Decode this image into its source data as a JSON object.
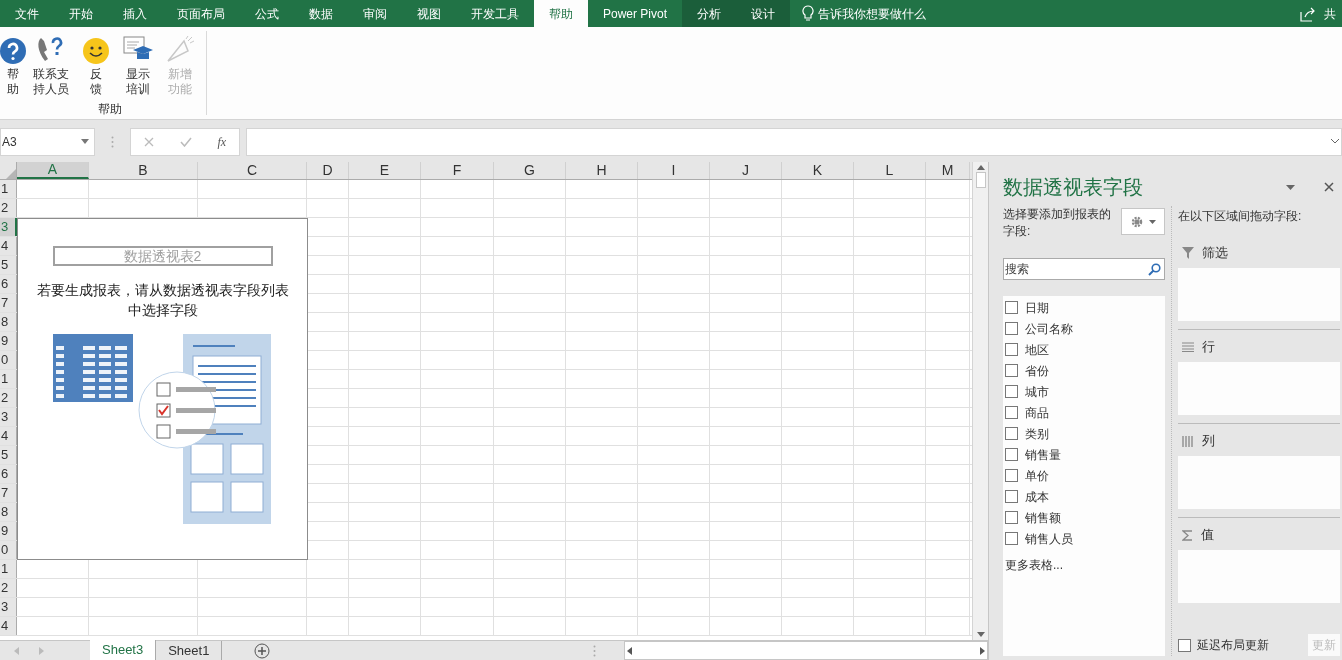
{
  "ribbon_tabs": [
    {
      "label": "文件",
      "selected": false,
      "kind": "normal"
    },
    {
      "label": "开始",
      "selected": false,
      "kind": "normal"
    },
    {
      "label": "插入",
      "selected": false,
      "kind": "normal"
    },
    {
      "label": "页面布局",
      "selected": false,
      "kind": "normal"
    },
    {
      "label": "公式",
      "selected": false,
      "kind": "normal"
    },
    {
      "label": "数据",
      "selected": false,
      "kind": "normal"
    },
    {
      "label": "审阅",
      "selected": false,
      "kind": "normal"
    },
    {
      "label": "视图",
      "selected": false,
      "kind": "normal"
    },
    {
      "label": "开发工具",
      "selected": false,
      "kind": "normal"
    },
    {
      "label": "帮助",
      "selected": true,
      "kind": "normal"
    },
    {
      "label": "Power Pivot",
      "selected": false,
      "kind": "normal"
    },
    {
      "label": "分析",
      "selected": false,
      "kind": "contextual"
    },
    {
      "label": "设计",
      "selected": false,
      "kind": "contextual"
    }
  ],
  "tell_me": "告诉我你想要做什么",
  "share": "共",
  "ribbon_group": {
    "label": "帮助",
    "buttons": [
      {
        "kind": "help",
        "lines": [
          "帮",
          "助"
        ],
        "disabled": false
      },
      {
        "kind": "contact",
        "lines": [
          "联系支",
          "持人员"
        ],
        "disabled": false
      },
      {
        "kind": "feedback",
        "lines": [
          "反",
          "馈"
        ],
        "disabled": false
      },
      {
        "kind": "training",
        "lines": [
          "显示",
          "培训"
        ],
        "disabled": false
      },
      {
        "kind": "whatsnew",
        "lines": [
          "新增",
          "功能"
        ],
        "disabled": true
      }
    ]
  },
  "name_box": "A3",
  "formula_fx": "fx",
  "columns": [
    {
      "label": "A",
      "selected": true
    },
    {
      "label": "B",
      "selected": false
    },
    {
      "label": "C",
      "selected": false
    },
    {
      "label": "D",
      "selected": false
    },
    {
      "label": "E",
      "selected": false
    },
    {
      "label": "F",
      "selected": false
    },
    {
      "label": "G",
      "selected": false
    },
    {
      "label": "H",
      "selected": false
    },
    {
      "label": "I",
      "selected": false
    },
    {
      "label": "J",
      "selected": false
    },
    {
      "label": "K",
      "selected": false
    },
    {
      "label": "L",
      "selected": false
    },
    {
      "label": "M",
      "selected": false
    }
  ],
  "rows": [
    {
      "label": "1",
      "selected": false
    },
    {
      "label": "2",
      "selected": false
    },
    {
      "label": "3",
      "selected": true
    },
    {
      "label": "4",
      "selected": false
    },
    {
      "label": "5",
      "selected": false
    },
    {
      "label": "6",
      "selected": false
    },
    {
      "label": "7",
      "selected": false
    },
    {
      "label": "8",
      "selected": false
    },
    {
      "label": "9",
      "selected": false
    },
    {
      "label": "0",
      "selected": false
    },
    {
      "label": "1",
      "selected": false
    },
    {
      "label": "2",
      "selected": false
    },
    {
      "label": "3",
      "selected": false
    },
    {
      "label": "4",
      "selected": false
    },
    {
      "label": "5",
      "selected": false
    },
    {
      "label": "6",
      "selected": false
    },
    {
      "label": "7",
      "selected": false
    },
    {
      "label": "8",
      "selected": false
    },
    {
      "label": "9",
      "selected": false
    },
    {
      "label": "0",
      "selected": false
    },
    {
      "label": "1",
      "selected": false
    },
    {
      "label": "2",
      "selected": false
    },
    {
      "label": "3",
      "selected": false
    },
    {
      "label": "4",
      "selected": false
    }
  ],
  "pivot_placeholder": {
    "title": "数据透视表2",
    "message": "若要生成报表，请从数据透视表字段列表中选择字段"
  },
  "pane": {
    "title": "数据透视表字段",
    "choose_label": "选择要添加到报表的字段:",
    "search": {
      "placeholder": "搜索"
    },
    "fields": [
      {
        "label": "日期",
        "checked": false
      },
      {
        "label": "公司名称",
        "checked": false
      },
      {
        "label": "地区",
        "checked": false
      },
      {
        "label": "省份",
        "checked": false
      },
      {
        "label": "城市",
        "checked": false
      },
      {
        "label": "商品",
        "checked": false
      },
      {
        "label": "类别",
        "checked": false
      },
      {
        "label": "销售量",
        "checked": false
      },
      {
        "label": "单价",
        "checked": false
      },
      {
        "label": "成本",
        "checked": false
      },
      {
        "label": "销售额",
        "checked": false
      },
      {
        "label": "销售人员",
        "checked": false
      }
    ],
    "more_tables": "更多表格...",
    "drag_label": "在以下区域间拖动字段:",
    "areas": [
      {
        "kind": "filter",
        "label": "筛选"
      },
      {
        "kind": "rows",
        "label": "行"
      },
      {
        "kind": "columns",
        "label": "列"
      },
      {
        "kind": "values",
        "label": "值"
      }
    ],
    "defer": {
      "label": "延迟布局更新",
      "checked": false
    },
    "update_button": {
      "label": "更新",
      "disabled": true
    }
  },
  "sheets": [
    {
      "label": "Sheet3",
      "selected": true
    },
    {
      "label": "Sheet1",
      "selected": false
    }
  ]
}
